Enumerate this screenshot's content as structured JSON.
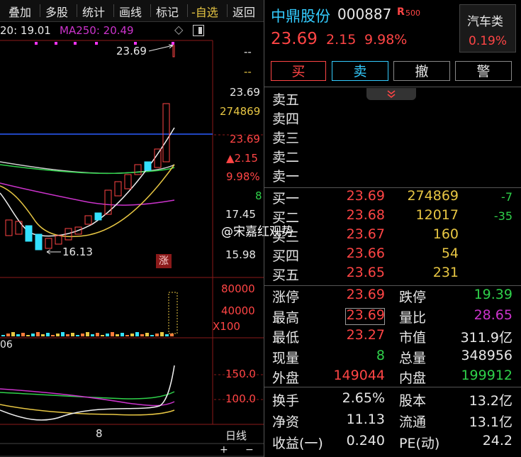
{
  "colors": {
    "red": "#ff4545",
    "green": "#2fd14a",
    "yellow": "#e7c643",
    "cyan": "#33ccff",
    "purple": "#cc33cc",
    "blue": "#2a5cff",
    "white": "#e8e8e8"
  },
  "toolbar": {
    "items": [
      "叠加",
      "多股",
      "统计",
      "画线",
      "标记",
      "-自选",
      "返回"
    ]
  },
  "chart": {
    "ma_label": "20: 19.01",
    "ma250_label": "MA250: 20.49",
    "diamond_icon": "◇",
    "high_marker": "23.69",
    "low_marker": "16.13",
    "limit_tag": "涨",
    "x_tick": "8",
    "macd_prefix": "06",
    "axis": {
      "p_dash1": "--",
      "p_dash2": "--",
      "p_price": "23.69",
      "p_vol": "274869",
      "p_price2": "23.69",
      "p_chg": "▲2.15",
      "p_pct": "9.98%",
      "p_8": "8",
      "p_1745": "17.45",
      "p_1598": "15.98",
      "v_80000": "80000",
      "v_40000": "40000",
      "v_x100": "X100",
      "i_150": "150.0",
      "i_100": "100.0",
      "period": "日线",
      "plus": "+",
      "minus": "−"
    }
  },
  "stock": {
    "name": "中鼎股份",
    "code": "000887",
    "badge": "R",
    "badge_sub": "500",
    "price": "23.69",
    "change": "2.15",
    "change_pct": "9.98%",
    "sector_name": "汽车类",
    "sector_pct": "0.19%"
  },
  "buttons": {
    "buy": "买",
    "sell": "卖",
    "cancel": "撤",
    "alert": "警"
  },
  "collapse_icon": "chevron-double-down-icon",
  "order_book": {
    "sells": [
      {
        "label": "卖五",
        "price": "",
        "vol": ""
      },
      {
        "label": "卖四",
        "price": "",
        "vol": ""
      },
      {
        "label": "卖三",
        "price": "",
        "vol": ""
      },
      {
        "label": "卖二",
        "price": "",
        "vol": ""
      },
      {
        "label": "卖一",
        "price": "",
        "vol": ""
      }
    ],
    "buys": [
      {
        "label": "买一",
        "price": "23.69",
        "vol": "274869",
        "chg": "-7"
      },
      {
        "label": "买二",
        "price": "23.68",
        "vol": "12017",
        "chg": "-35"
      },
      {
        "label": "买三",
        "price": "23.67",
        "vol": "160",
        "chg": ""
      },
      {
        "label": "买四",
        "price": "23.66",
        "vol": "54",
        "chg": ""
      },
      {
        "label": "买五",
        "price": "23.65",
        "vol": "231",
        "chg": ""
      }
    ]
  },
  "stats": [
    {
      "l1": "涨停",
      "v1": "23.69",
      "c1": "red",
      "l2": "跌停",
      "v2": "19.39",
      "c2": "green"
    },
    {
      "l1": "最高",
      "v1": "23.69",
      "c1": "red",
      "l2": "量比",
      "v2": "28.65",
      "c2": "purple"
    },
    {
      "l1": "最低",
      "v1": "23.27",
      "c1": "red",
      "l2": "市值",
      "v2": "311.9亿",
      "c2": "white"
    },
    {
      "l1": "现量",
      "v1": "8",
      "c1": "green",
      "l2": "总量",
      "v2": "348956",
      "c2": "white"
    },
    {
      "l1": "外盘",
      "v1": "149044",
      "c1": "red",
      "l2": "内盘",
      "v2": "199912",
      "c2": "green"
    },
    {
      "l1": "换手",
      "v1": "2.65%",
      "c1": "white",
      "l2": "股本",
      "v2": "13.2亿",
      "c2": "white"
    },
    {
      "l1": "净资",
      "v1": "11.13",
      "c1": "white",
      "l2": "流通",
      "v2": "13.1亿",
      "c2": "white"
    },
    {
      "l1": "收益(一)",
      "v1": "0.240",
      "c1": "white",
      "l2": "PE(动)",
      "v2": "24.2",
      "c2": "white"
    }
  ],
  "watermark": "@宋嘉红观势"
}
